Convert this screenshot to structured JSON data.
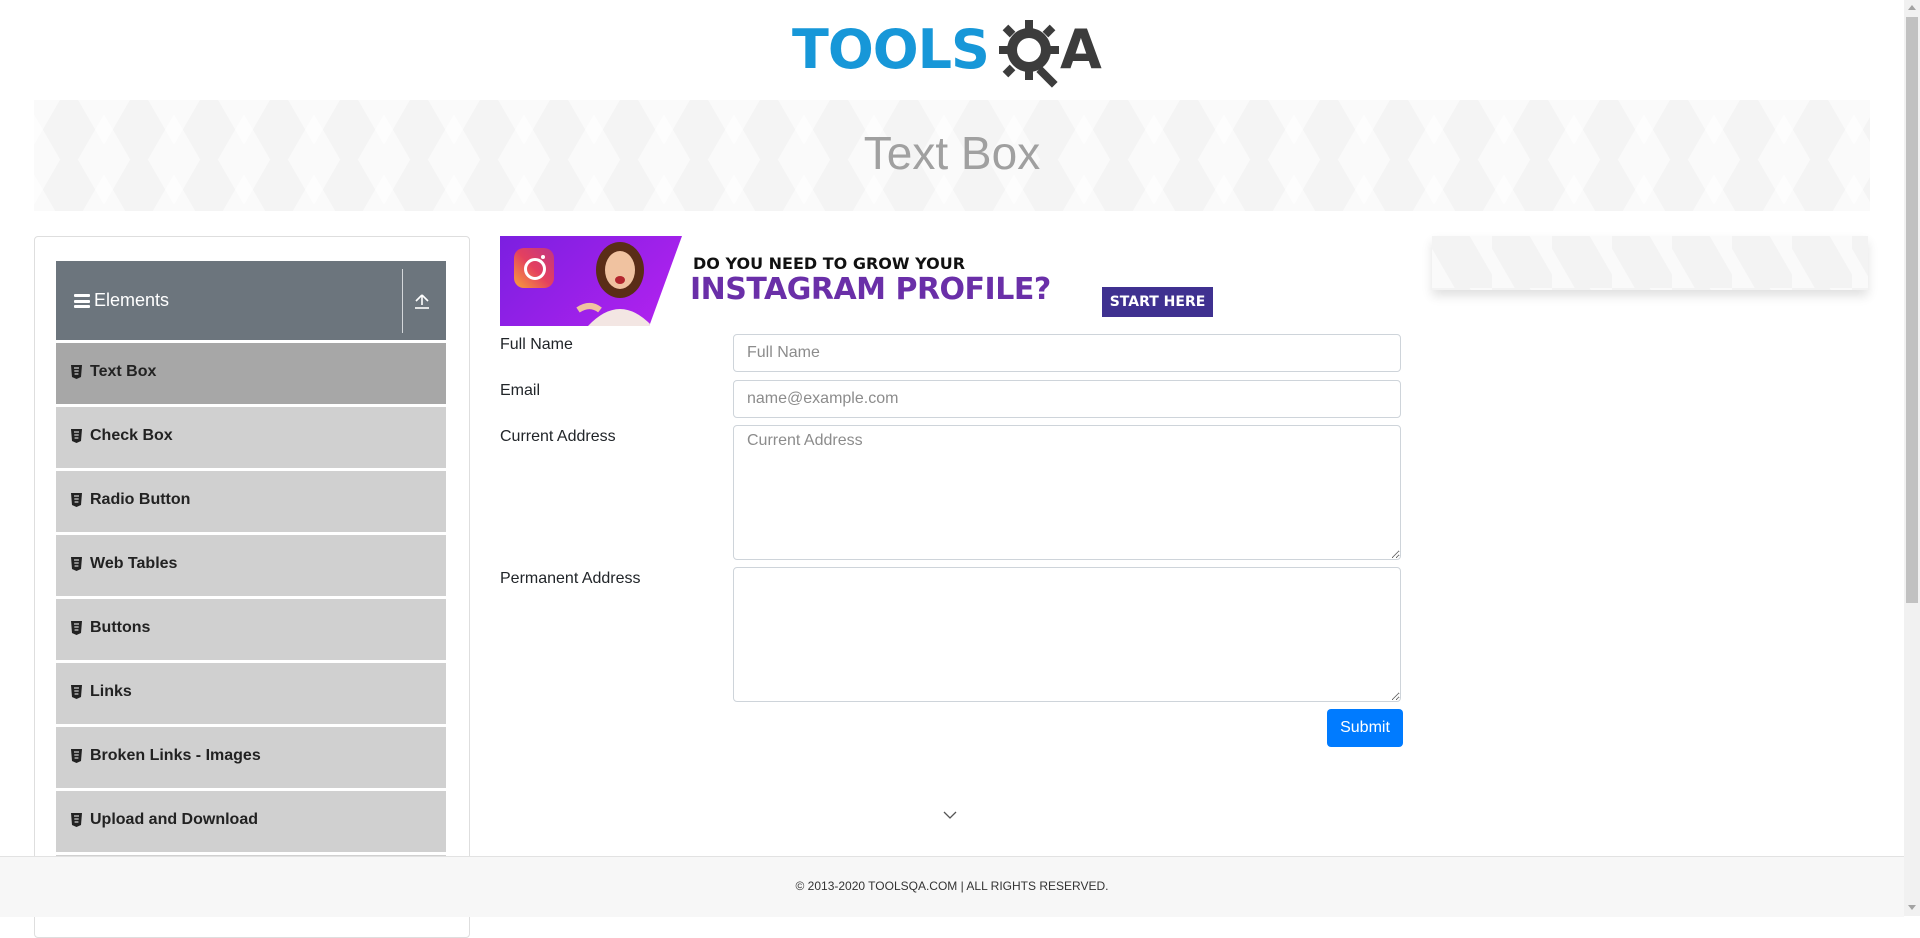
{
  "header": {
    "logo_text_primary": "TOOLS",
    "logo_text_secondary": "A",
    "logo_alt": "TOOLSQA"
  },
  "banner": {
    "title": "Text Box"
  },
  "sidebar": {
    "group_title": "Elements",
    "group_icon": "hamburger-icon",
    "collapse_icon": "upload-arrow-icon",
    "items": [
      {
        "label": "Text Box",
        "active": true
      },
      {
        "label": "Check Box",
        "active": false
      },
      {
        "label": "Radio Button",
        "active": false
      },
      {
        "label": "Web Tables",
        "active": false
      },
      {
        "label": "Buttons",
        "active": false
      },
      {
        "label": "Links",
        "active": false
      },
      {
        "label": "Broken Links - Images",
        "active": false
      },
      {
        "label": "Upload and Download",
        "active": false
      }
    ]
  },
  "ad": {
    "line1": "DO YOU NEED TO GROW YOUR",
    "line2": "INSTAGRAM PROFILE?",
    "cta": "START HERE"
  },
  "form": {
    "full_name_label": "Full Name",
    "full_name_placeholder": "Full Name",
    "email_label": "Email",
    "email_placeholder": "name@example.com",
    "current_address_label": "Current Address",
    "current_address_placeholder": "Current Address",
    "permanent_address_label": "Permanent Address",
    "submit_label": "Submit"
  },
  "footer": {
    "text": "© 2013-2020 TOOLSQA.COM | ALL RIGHTS RESERVED."
  },
  "colors": {
    "brand_blue": "#1797d8",
    "submit_blue": "#007bff",
    "sidebar_header": "#6c757d",
    "menu_active": "#a7a7a7",
    "menu_item": "#d0d0d0"
  }
}
